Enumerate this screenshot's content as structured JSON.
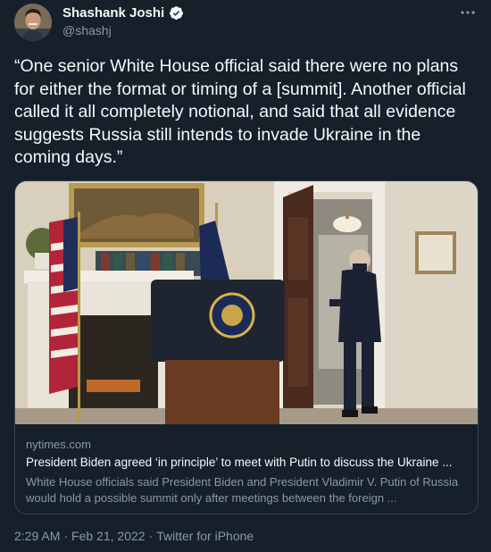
{
  "author": {
    "name": "Shashank Joshi",
    "handle": "@shashj"
  },
  "tweet_text": "“One senior White House official said there were no plans for either the format or timing of a [summit]. Another official called it all completely notional, and said that all evidence suggests Russia still intends to invade Ukraine in the coming days.”",
  "link_card": {
    "domain": "nytimes.com",
    "title": "President Biden agreed ‘in principle’ to meet with Putin to discuss the Ukraine ...",
    "description": "White House officials said President Biden and President Vladimir V. Putin of Russia would hold a possible summit only after meetings between the foreign ..."
  },
  "timestamp": {
    "time": "2:29 AM",
    "date": "Feb 21, 2022",
    "source": "Twitter for iPhone"
  },
  "icons": {
    "verified": "verified-badge-icon",
    "more": "more-horizontal-icon"
  },
  "colors": {
    "background": "#15202b",
    "text": "#f7f9f9",
    "secondary": "#8b98a5",
    "border": "#38444d",
    "verified": "#f7f9f9"
  }
}
